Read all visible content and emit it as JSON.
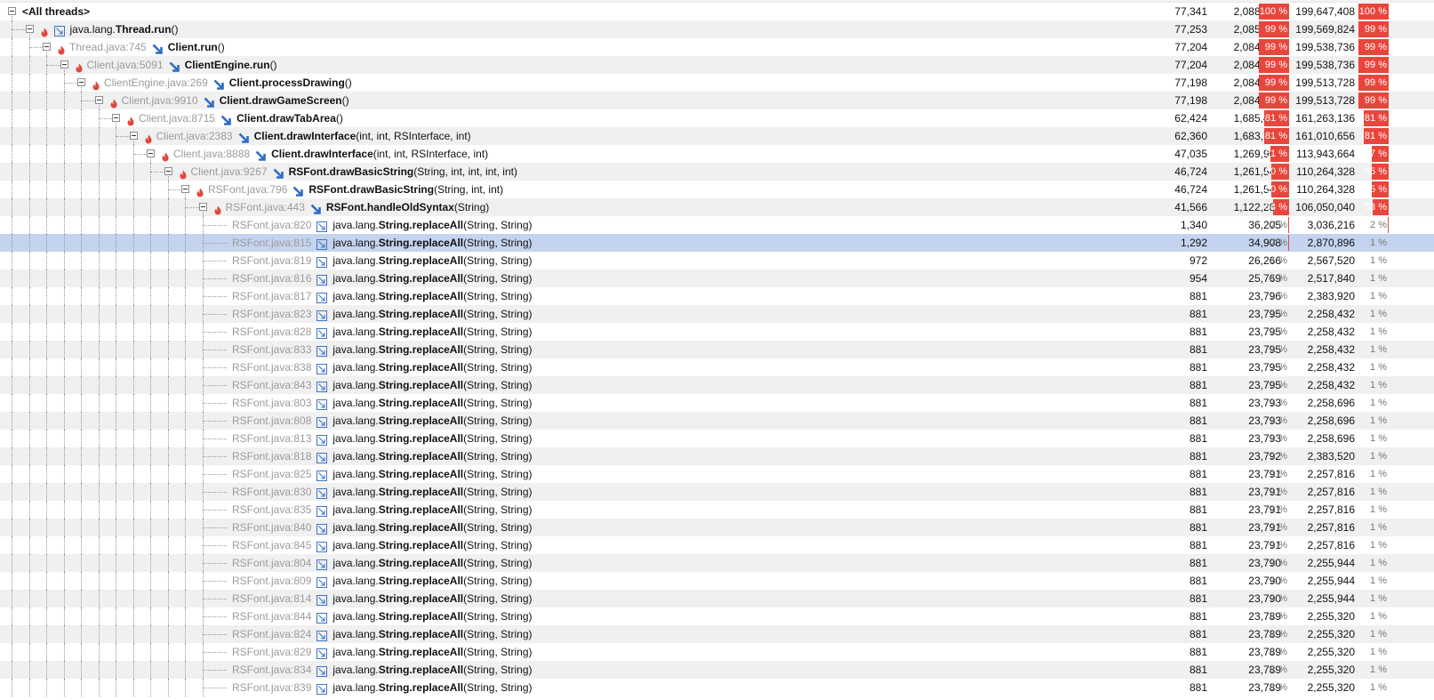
{
  "colors": {
    "selection": "#c5d4ee",
    "hotspot_bar": "#e8463c",
    "alt_row": "#f0f0f0"
  },
  "rows": [
    {
      "depth": 0,
      "toggle": true,
      "hot": false,
      "arrow": "none",
      "loc": "",
      "pkg": "",
      "cls": "<All threads>",
      "sig": "",
      "count": "77,341",
      "time": "2,088,212",
      "time_pct": "100 %",
      "time_frac": 1.0,
      "own": "199,647,408",
      "own_pct": "100 %",
      "own_frac": 1.0
    },
    {
      "depth": 1,
      "toggle": true,
      "hot": true,
      "arrow": "outline",
      "loc": "",
      "pkg": "java.lang.",
      "cls": "Thread.run",
      "sig": "()",
      "count": "77,253",
      "time": "2,085,834",
      "time_pct": "99 %",
      "time_frac": 0.99,
      "own": "199,569,824",
      "own_pct": "99 %",
      "own_frac": 0.99
    },
    {
      "depth": 2,
      "toggle": true,
      "hot": true,
      "arrow": "solid",
      "loc": "Thread.java:745",
      "pkg": "",
      "cls": "Client.run",
      "sig": "()",
      "count": "77,204",
      "time": "2,084,518",
      "time_pct": "99 %",
      "time_frac": 0.99,
      "own": "199,538,736",
      "own_pct": "99 %",
      "own_frac": 0.99
    },
    {
      "depth": 3,
      "toggle": true,
      "hot": true,
      "arrow": "solid",
      "loc": "Client.java:5091",
      "pkg": "",
      "cls": "ClientEngine.run",
      "sig": "()",
      "count": "77,204",
      "time": "2,084,518",
      "time_pct": "99 %",
      "time_frac": 0.99,
      "own": "199,538,736",
      "own_pct": "99 %",
      "own_frac": 0.99
    },
    {
      "depth": 4,
      "toggle": true,
      "hot": true,
      "arrow": "solid",
      "loc": "ClientEngine.java:269",
      "pkg": "",
      "cls": "Client.processDrawing",
      "sig": "()",
      "count": "77,198",
      "time": "2,084,353",
      "time_pct": "99 %",
      "time_frac": 0.99,
      "own": "199,513,728",
      "own_pct": "99 %",
      "own_frac": 0.99
    },
    {
      "depth": 5,
      "toggle": true,
      "hot": true,
      "arrow": "solid",
      "loc": "Client.java:9910",
      "pkg": "",
      "cls": "Client.drawGameScreen",
      "sig": "()",
      "count": "77,198",
      "time": "2,084,353",
      "time_pct": "99 %",
      "time_frac": 0.99,
      "own": "199,513,728",
      "own_pct": "99 %",
      "own_frac": 0.99
    },
    {
      "depth": 6,
      "toggle": true,
      "hot": true,
      "arrow": "solid",
      "loc": "Client.java:8715",
      "pkg": "",
      "cls": "Client.drawTabArea",
      "sig": "()",
      "count": "62,424",
      "time": "1,685,472",
      "time_pct": "81 %",
      "time_frac": 0.81,
      "own": "161,263,136",
      "own_pct": "81 %",
      "own_frac": 0.81
    },
    {
      "depth": 7,
      "toggle": true,
      "hot": true,
      "arrow": "solid",
      "loc": "Client.java:2383",
      "pkg": "",
      "cls": "Client.drawInterface",
      "sig": "(int, int, RSInterface, int)",
      "count": "62,360",
      "time": "1,683,723",
      "time_pct": "81 %",
      "time_frac": 0.81,
      "own": "161,010,656",
      "own_pct": "81 %",
      "own_frac": 0.81
    },
    {
      "depth": 8,
      "toggle": true,
      "hot": true,
      "arrow": "solid",
      "loc": "Client.java:8888",
      "pkg": "",
      "cls": "Client.drawInterface",
      "sig": "(int, int, RSInterface, int)",
      "count": "47,035",
      "time": "1,269,969",
      "time_pct": "61 %",
      "time_frac": 0.61,
      "own": "113,943,664",
      "own_pct": "57 %",
      "own_frac": 0.57
    },
    {
      "depth": 9,
      "toggle": true,
      "hot": true,
      "arrow": "solid",
      "loc": "Client.java:9267",
      "pkg": "",
      "cls": "RSFont.drawBasicString",
      "sig": "(String, int, int, int, int)",
      "count": "46,724",
      "time": "1,261,548",
      "time_pct": "60 %",
      "time_frac": 0.6,
      "own": "110,264,328",
      "own_pct": "55 %",
      "own_frac": 0.55
    },
    {
      "depth": 10,
      "toggle": true,
      "hot": true,
      "arrow": "solid",
      "loc": "RSFont.java:796",
      "pkg": "",
      "cls": "RSFont.drawBasicString",
      "sig": "(String, int, int)",
      "count": "46,724",
      "time": "1,261,548",
      "time_pct": "60 %",
      "time_frac": 0.6,
      "own": "110,264,328",
      "own_pct": "55 %",
      "own_frac": 0.55
    },
    {
      "depth": 11,
      "toggle": true,
      "hot": true,
      "arrow": "solid",
      "loc": "RSFont.java:443",
      "pkg": "",
      "cls": "RSFont.handleOldSyntax",
      "sig": "(String)",
      "count": "41,566",
      "time": "1,122,282",
      "time_pct": "54 %",
      "time_frac": 0.54,
      "own": "106,050,040",
      "own_pct": "53 %",
      "own_frac": 0.53
    },
    {
      "depth": 12,
      "toggle": false,
      "hot": false,
      "arrow": "outline",
      "loc": "RSFont.java:820",
      "pkg": "java.lang.",
      "cls": "String.replaceAll",
      "sig": "(String, String)",
      "count": "1,340",
      "time": "36,205",
      "time_pct": "2 %",
      "time_frac": 0.02,
      "own": "3,036,216",
      "own_pct": "2 %",
      "own_frac": 0.02
    },
    {
      "depth": 12,
      "toggle": false,
      "hot": false,
      "arrow": "outline",
      "selected": true,
      "loc": "RSFont.java:815",
      "pkg": "java.lang.",
      "cls": "String.replaceAll",
      "sig": "(String, String)",
      "count": "1,292",
      "time": "34,908",
      "time_pct": "2 %",
      "time_frac": 0.02,
      "own": "2,870,896",
      "own_pct": "1 %",
      "own_frac": 0.01
    },
    {
      "depth": 12,
      "toggle": false,
      "hot": false,
      "arrow": "outline",
      "loc": "RSFont.java:819",
      "pkg": "java.lang.",
      "cls": "String.replaceAll",
      "sig": "(String, String)",
      "count": "972",
      "time": "26,266",
      "time_pct": "1 %",
      "time_frac": 0.01,
      "own": "2,567,520",
      "own_pct": "1 %",
      "own_frac": 0.01
    },
    {
      "depth": 12,
      "toggle": false,
      "hot": false,
      "arrow": "outline",
      "loc": "RSFont.java:816",
      "pkg": "java.lang.",
      "cls": "String.replaceAll",
      "sig": "(String, String)",
      "count": "954",
      "time": "25,769",
      "time_pct": "1 %",
      "time_frac": 0.01,
      "own": "2,517,840",
      "own_pct": "1 %",
      "own_frac": 0.01
    },
    {
      "depth": 12,
      "toggle": false,
      "hot": false,
      "arrow": "outline",
      "loc": "RSFont.java:817",
      "pkg": "java.lang.",
      "cls": "String.replaceAll",
      "sig": "(String, String)",
      "count": "881",
      "time": "23,796",
      "time_pct": "1 %",
      "time_frac": 0.01,
      "own": "2,383,920",
      "own_pct": "1 %",
      "own_frac": 0.01
    },
    {
      "depth": 12,
      "toggle": false,
      "hot": false,
      "arrow": "outline",
      "loc": "RSFont.java:823",
      "pkg": "java.lang.",
      "cls": "String.replaceAll",
      "sig": "(String, String)",
      "count": "881",
      "time": "23,795",
      "time_pct": "1 %",
      "time_frac": 0.01,
      "own": "2,258,432",
      "own_pct": "1 %",
      "own_frac": 0.01
    },
    {
      "depth": 12,
      "toggle": false,
      "hot": false,
      "arrow": "outline",
      "loc": "RSFont.java:828",
      "pkg": "java.lang.",
      "cls": "String.replaceAll",
      "sig": "(String, String)",
      "count": "881",
      "time": "23,795",
      "time_pct": "1 %",
      "time_frac": 0.01,
      "own": "2,258,432",
      "own_pct": "1 %",
      "own_frac": 0.01
    },
    {
      "depth": 12,
      "toggle": false,
      "hot": false,
      "arrow": "outline",
      "loc": "RSFont.java:833",
      "pkg": "java.lang.",
      "cls": "String.replaceAll",
      "sig": "(String, String)",
      "count": "881",
      "time": "23,795",
      "time_pct": "1 %",
      "time_frac": 0.01,
      "own": "2,258,432",
      "own_pct": "1 %",
      "own_frac": 0.01
    },
    {
      "depth": 12,
      "toggle": false,
      "hot": false,
      "arrow": "outline",
      "loc": "RSFont.java:838",
      "pkg": "java.lang.",
      "cls": "String.replaceAll",
      "sig": "(String, String)",
      "count": "881",
      "time": "23,795",
      "time_pct": "1 %",
      "time_frac": 0.01,
      "own": "2,258,432",
      "own_pct": "1 %",
      "own_frac": 0.01
    },
    {
      "depth": 12,
      "toggle": false,
      "hot": false,
      "arrow": "outline",
      "loc": "RSFont.java:843",
      "pkg": "java.lang.",
      "cls": "String.replaceAll",
      "sig": "(String, String)",
      "count": "881",
      "time": "23,795",
      "time_pct": "1 %",
      "time_frac": 0.01,
      "own": "2,258,432",
      "own_pct": "1 %",
      "own_frac": 0.01
    },
    {
      "depth": 12,
      "toggle": false,
      "hot": false,
      "arrow": "outline",
      "loc": "RSFont.java:803",
      "pkg": "java.lang.",
      "cls": "String.replaceAll",
      "sig": "(String, String)",
      "count": "881",
      "time": "23,793",
      "time_pct": "1 %",
      "time_frac": 0.01,
      "own": "2,258,696",
      "own_pct": "1 %",
      "own_frac": 0.01
    },
    {
      "depth": 12,
      "toggle": false,
      "hot": false,
      "arrow": "outline",
      "loc": "RSFont.java:808",
      "pkg": "java.lang.",
      "cls": "String.replaceAll",
      "sig": "(String, String)",
      "count": "881",
      "time": "23,793",
      "time_pct": "1 %",
      "time_frac": 0.01,
      "own": "2,258,696",
      "own_pct": "1 %",
      "own_frac": 0.01
    },
    {
      "depth": 12,
      "toggle": false,
      "hot": false,
      "arrow": "outline",
      "loc": "RSFont.java:813",
      "pkg": "java.lang.",
      "cls": "String.replaceAll",
      "sig": "(String, String)",
      "count": "881",
      "time": "23,793",
      "time_pct": "1 %",
      "time_frac": 0.01,
      "own": "2,258,696",
      "own_pct": "1 %",
      "own_frac": 0.01
    },
    {
      "depth": 12,
      "toggle": false,
      "hot": false,
      "arrow": "outline",
      "loc": "RSFont.java:818",
      "pkg": "java.lang.",
      "cls": "String.replaceAll",
      "sig": "(String, String)",
      "count": "881",
      "time": "23,792",
      "time_pct": "1 %",
      "time_frac": 0.01,
      "own": "2,383,520",
      "own_pct": "1 %",
      "own_frac": 0.01
    },
    {
      "depth": 12,
      "toggle": false,
      "hot": false,
      "arrow": "outline",
      "loc": "RSFont.java:825",
      "pkg": "java.lang.",
      "cls": "String.replaceAll",
      "sig": "(String, String)",
      "count": "881",
      "time": "23,791",
      "time_pct": "1 %",
      "time_frac": 0.01,
      "own": "2,257,816",
      "own_pct": "1 %",
      "own_frac": 0.01
    },
    {
      "depth": 12,
      "toggle": false,
      "hot": false,
      "arrow": "outline",
      "loc": "RSFont.java:830",
      "pkg": "java.lang.",
      "cls": "String.replaceAll",
      "sig": "(String, String)",
      "count": "881",
      "time": "23,791",
      "time_pct": "1 %",
      "time_frac": 0.01,
      "own": "2,257,816",
      "own_pct": "1 %",
      "own_frac": 0.01
    },
    {
      "depth": 12,
      "toggle": false,
      "hot": false,
      "arrow": "outline",
      "loc": "RSFont.java:835",
      "pkg": "java.lang.",
      "cls": "String.replaceAll",
      "sig": "(String, String)",
      "count": "881",
      "time": "23,791",
      "time_pct": "1 %",
      "time_frac": 0.01,
      "own": "2,257,816",
      "own_pct": "1 %",
      "own_frac": 0.01
    },
    {
      "depth": 12,
      "toggle": false,
      "hot": false,
      "arrow": "outline",
      "loc": "RSFont.java:840",
      "pkg": "java.lang.",
      "cls": "String.replaceAll",
      "sig": "(String, String)",
      "count": "881",
      "time": "23,791",
      "time_pct": "1 %",
      "time_frac": 0.01,
      "own": "2,257,816",
      "own_pct": "1 %",
      "own_frac": 0.01
    },
    {
      "depth": 12,
      "toggle": false,
      "hot": false,
      "arrow": "outline",
      "loc": "RSFont.java:845",
      "pkg": "java.lang.",
      "cls": "String.replaceAll",
      "sig": "(String, String)",
      "count": "881",
      "time": "23,791",
      "time_pct": "1 %",
      "time_frac": 0.01,
      "own": "2,257,816",
      "own_pct": "1 %",
      "own_frac": 0.01
    },
    {
      "depth": 12,
      "toggle": false,
      "hot": false,
      "arrow": "outline",
      "loc": "RSFont.java:804",
      "pkg": "java.lang.",
      "cls": "String.replaceAll",
      "sig": "(String, String)",
      "count": "881",
      "time": "23,790",
      "time_pct": "1 %",
      "time_frac": 0.01,
      "own": "2,255,944",
      "own_pct": "1 %",
      "own_frac": 0.01
    },
    {
      "depth": 12,
      "toggle": false,
      "hot": false,
      "arrow": "outline",
      "loc": "RSFont.java:809",
      "pkg": "java.lang.",
      "cls": "String.replaceAll",
      "sig": "(String, String)",
      "count": "881",
      "time": "23,790",
      "time_pct": "1 %",
      "time_frac": 0.01,
      "own": "2,255,944",
      "own_pct": "1 %",
      "own_frac": 0.01
    },
    {
      "depth": 12,
      "toggle": false,
      "hot": false,
      "arrow": "outline",
      "loc": "RSFont.java:814",
      "pkg": "java.lang.",
      "cls": "String.replaceAll",
      "sig": "(String, String)",
      "count": "881",
      "time": "23,790",
      "time_pct": "1 %",
      "time_frac": 0.01,
      "own": "2,255,944",
      "own_pct": "1 %",
      "own_frac": 0.01
    },
    {
      "depth": 12,
      "toggle": false,
      "hot": false,
      "arrow": "outline",
      "loc": "RSFont.java:844",
      "pkg": "java.lang.",
      "cls": "String.replaceAll",
      "sig": "(String, String)",
      "count": "881",
      "time": "23,789",
      "time_pct": "1 %",
      "time_frac": 0.01,
      "own": "2,255,320",
      "own_pct": "1 %",
      "own_frac": 0.01
    },
    {
      "depth": 12,
      "toggle": false,
      "hot": false,
      "arrow": "outline",
      "loc": "RSFont.java:824",
      "pkg": "java.lang.",
      "cls": "String.replaceAll",
      "sig": "(String, String)",
      "count": "881",
      "time": "23,789",
      "time_pct": "1 %",
      "time_frac": 0.01,
      "own": "2,255,320",
      "own_pct": "1 %",
      "own_frac": 0.01
    },
    {
      "depth": 12,
      "toggle": false,
      "hot": false,
      "arrow": "outline",
      "loc": "RSFont.java:829",
      "pkg": "java.lang.",
      "cls": "String.replaceAll",
      "sig": "(String, String)",
      "count": "881",
      "time": "23,789",
      "time_pct": "1 %",
      "time_frac": 0.01,
      "own": "2,255,320",
      "own_pct": "1 %",
      "own_frac": 0.01
    },
    {
      "depth": 12,
      "toggle": false,
      "hot": false,
      "arrow": "outline",
      "loc": "RSFont.java:834",
      "pkg": "java.lang.",
      "cls": "String.replaceAll",
      "sig": "(String, String)",
      "count": "881",
      "time": "23,789",
      "time_pct": "1 %",
      "time_frac": 0.01,
      "own": "2,255,320",
      "own_pct": "1 %",
      "own_frac": 0.01
    },
    {
      "depth": 12,
      "toggle": false,
      "hot": false,
      "arrow": "outline",
      "loc": "RSFont.java:839",
      "pkg": "java.lang.",
      "cls": "String.replaceAll",
      "sig": "(String, String)",
      "count": "881",
      "time": "23,789",
      "time_pct": "1 %",
      "time_frac": 0.01,
      "own": "2,255,320",
      "own_pct": "1 %",
      "own_frac": 0.01
    }
  ]
}
